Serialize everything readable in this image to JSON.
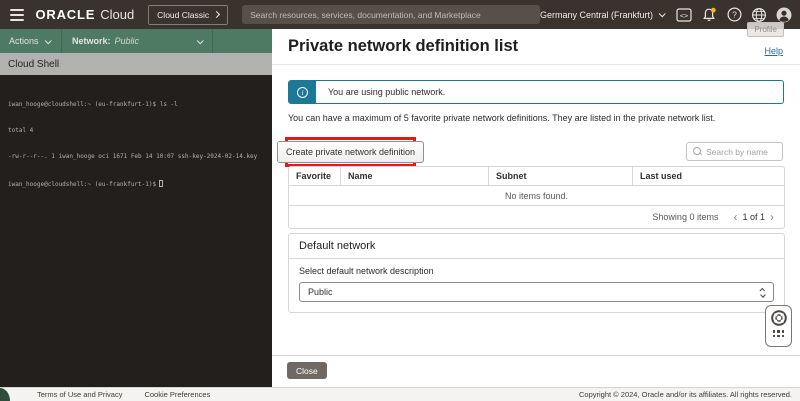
{
  "topbar": {
    "logo_oracle": "ORACLE",
    "logo_cloud": "Cloud",
    "cloud_classic_label": "Cloud Classic",
    "search_placeholder": "Search resources, services, documentation, and Marketplace",
    "region_label": "Germany Central (Frankfurt)",
    "devconsole_glyph": "<>",
    "question_glyph": "?"
  },
  "shell": {
    "actions_label": "Actions",
    "network_label": "Network:",
    "network_value": "Public",
    "panel_title": "Cloud Shell",
    "terminal_lines": [
      "iwan_hooge@cloudshell:~ (eu-frankfurt-1)$ ls -l",
      "total 4",
      "-rw-r--r--. 1 iwan_hooge oci 1671 Feb 14 10:07 ssh-key-2024-02-14.key",
      "iwan_hooge@cloudshell:~ (eu-frankfurt-1)$"
    ]
  },
  "main": {
    "title": "Private network definition list",
    "help_link": "Help",
    "profile_tooltip": "Profile",
    "info_banner": "You are using public network.",
    "info_icon_glyph": "i",
    "description": "You can have a maximum of 5 favorite private network definitions. They are listed in the private network list.",
    "create_button": "Create private network definition",
    "search_placeholder": "Search by name",
    "table": {
      "columns": [
        "Favorite",
        "Name",
        "Subnet",
        "Last used"
      ],
      "empty_text": "No items found.",
      "showing_text": "Showing 0 items",
      "prev_glyph": "‹",
      "next_glyph": "›",
      "pagination": "1 of 1"
    },
    "default_network": {
      "title": "Default network",
      "select_label": "Select default network description",
      "select_value": "Public"
    },
    "close_button": "Close"
  },
  "footer": {
    "terms_link": "Terms of Use and Privacy",
    "cookie_link": "Cookie Preferences",
    "copyright": "Copyright © 2024, Oracle and/or its affiliates. All rights reserved."
  },
  "colors": {
    "topbar_bg": "#39322d",
    "shell_green": "#4e7963",
    "shell_titlebar_gray": "#b1b1af",
    "terminal_bg": "#221f1c",
    "banner_teal": "#1c7895",
    "annotation_red": "#e01a1a",
    "link_blue": "#2a6a9a",
    "notification_dot_yellow": "#f0b429",
    "close_button_bg": "#6f6863"
  }
}
